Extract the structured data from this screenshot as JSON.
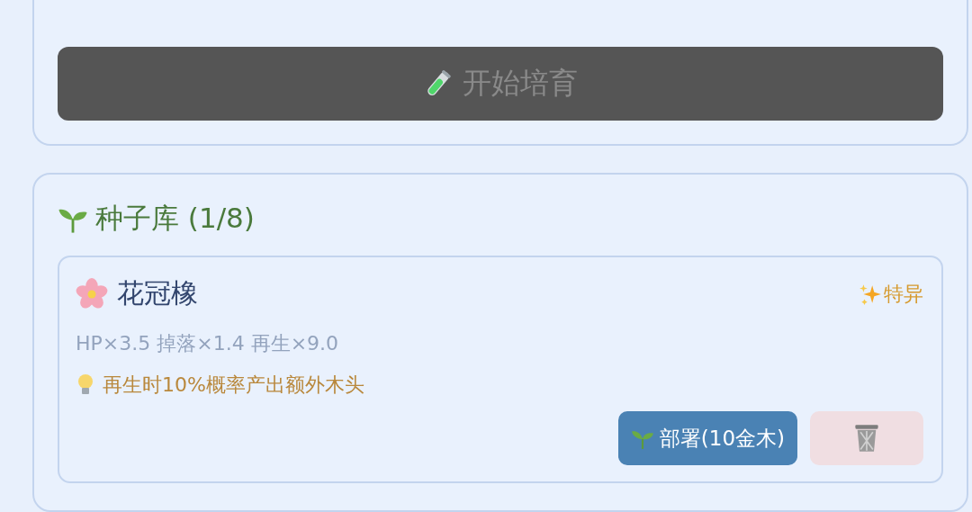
{
  "breed_panel": {
    "start_button": {
      "label": "开始培育",
      "disabled": true
    }
  },
  "seed_bank": {
    "title": "种子库 (1/8)",
    "seeds": [
      {
        "name": "花冠橡",
        "tag": "特异",
        "stats": "HP×3.5 掉落×1.4 再生×9.0",
        "tip": "再生时10%概率产出额外木头",
        "deploy_label": "部署(10金木)"
      }
    ]
  }
}
